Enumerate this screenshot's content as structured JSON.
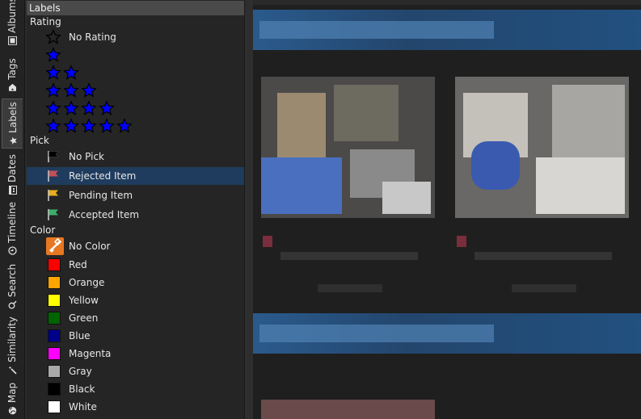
{
  "side_tabs": [
    {
      "label": "Albums",
      "icon": "album-icon"
    },
    {
      "label": "Tags",
      "icon": "tag-icon"
    },
    {
      "label": "Labels",
      "icon": "star-icon"
    },
    {
      "label": "Dates",
      "icon": "calendar-icon"
    },
    {
      "label": "Timeline",
      "icon": "clock-icon"
    },
    {
      "label": "Search",
      "icon": "search-icon"
    },
    {
      "label": "Similarity",
      "icon": "wand-icon"
    },
    {
      "label": "Map",
      "icon": "globe-icon"
    }
  ],
  "active_tab": "Labels",
  "panel": {
    "title": "Labels",
    "rating": {
      "header": "Rating",
      "items": [
        {
          "label": "No Rating",
          "stars": 0
        },
        {
          "label": "",
          "stars": 1
        },
        {
          "label": "",
          "stars": 2
        },
        {
          "label": "",
          "stars": 3
        },
        {
          "label": "",
          "stars": 4
        },
        {
          "label": "",
          "stars": 5
        }
      ]
    },
    "pick": {
      "header": "Pick",
      "items": [
        {
          "label": "No Pick",
          "color": "#000000",
          "selected": false
        },
        {
          "label": "Rejected Item",
          "color": "#c0505a",
          "selected": true
        },
        {
          "label": "Pending Item",
          "color": "#e6b020",
          "selected": false
        },
        {
          "label": "Accepted Item",
          "color": "#3fae6a",
          "selected": false
        }
      ]
    },
    "color": {
      "header": "Color",
      "items": [
        {
          "label": "No Color",
          "color": "#e87722"
        },
        {
          "label": "Red",
          "color": "#ff0000"
        },
        {
          "label": "Orange",
          "color": "#ffa500"
        },
        {
          "label": "Yellow",
          "color": "#ffff00"
        },
        {
          "label": "Green",
          "color": "#006400"
        },
        {
          "label": "Blue",
          "color": "#00008b"
        },
        {
          "label": "Magenta",
          "color": "#ff00ff"
        },
        {
          "label": "Gray",
          "color": "#a9a9a9"
        },
        {
          "label": "Black",
          "color": "#000000"
        },
        {
          "label": "White",
          "color": "#ffffff"
        }
      ]
    }
  },
  "colors": {
    "star_fill": "#0000ff",
    "selection": "#1f3c5e"
  }
}
